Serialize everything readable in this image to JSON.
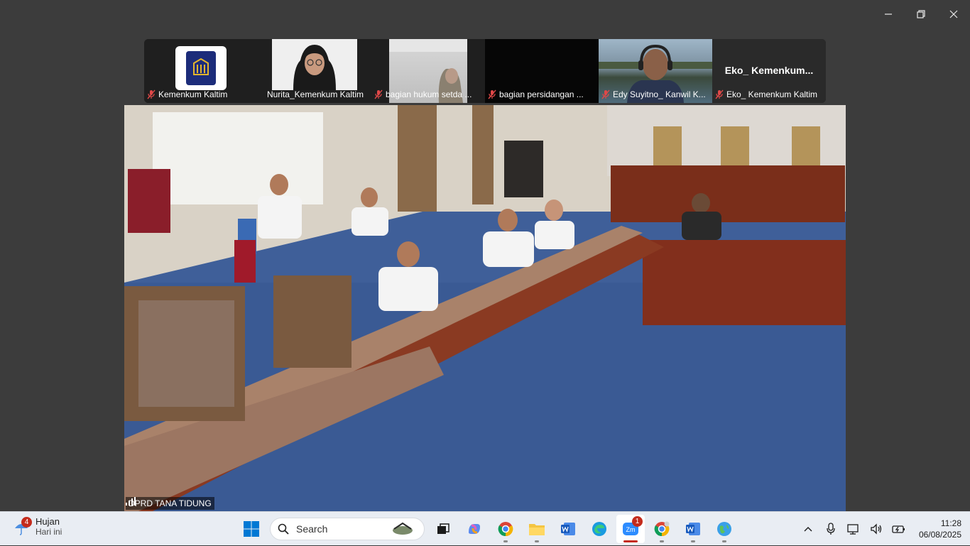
{
  "window": {
    "controls": [
      "minimize",
      "restore",
      "close"
    ]
  },
  "participants": [
    {
      "name": "Kemenkum Kaltim",
      "muted": true,
      "video": "logo"
    },
    {
      "name": "Nurita_Kemenkum Kaltim",
      "muted": false,
      "video": "camera"
    },
    {
      "name": "bagian hukum setda ...",
      "muted": true,
      "video": "camera"
    },
    {
      "name": "bagian persidangan ...",
      "muted": true,
      "video": "off"
    },
    {
      "name": "Edy Suyitno_ Kanwil K...",
      "muted": true,
      "video": "camera"
    },
    {
      "name": "Eko_ Kemenkum Kaltim",
      "muted": true,
      "video": "off",
      "display_title": "Eko_ Kemenkum..."
    }
  ],
  "main_video": {
    "speaker_label": "DPRD TANA TIDUNG"
  },
  "taskbar": {
    "weather": {
      "badge": "4",
      "condition": "Hujan",
      "period": "Hari ini"
    },
    "search_placeholder": "Search",
    "apps": [
      "windows-start",
      "search",
      "task-view",
      "copilot",
      "chrome",
      "file-explorer",
      "word",
      "edge",
      "zoom",
      "chrome-profile",
      "word-doc",
      "maps"
    ],
    "zoom_badge": "1",
    "clock": {
      "time": "11:28",
      "date": "06/08/2025"
    }
  },
  "colors": {
    "taskbar_bg": "#e9edf3",
    "desktop_bg": "#3c3c3c",
    "accent_red": "#c42b1c",
    "start_blue": "#0078d4"
  }
}
